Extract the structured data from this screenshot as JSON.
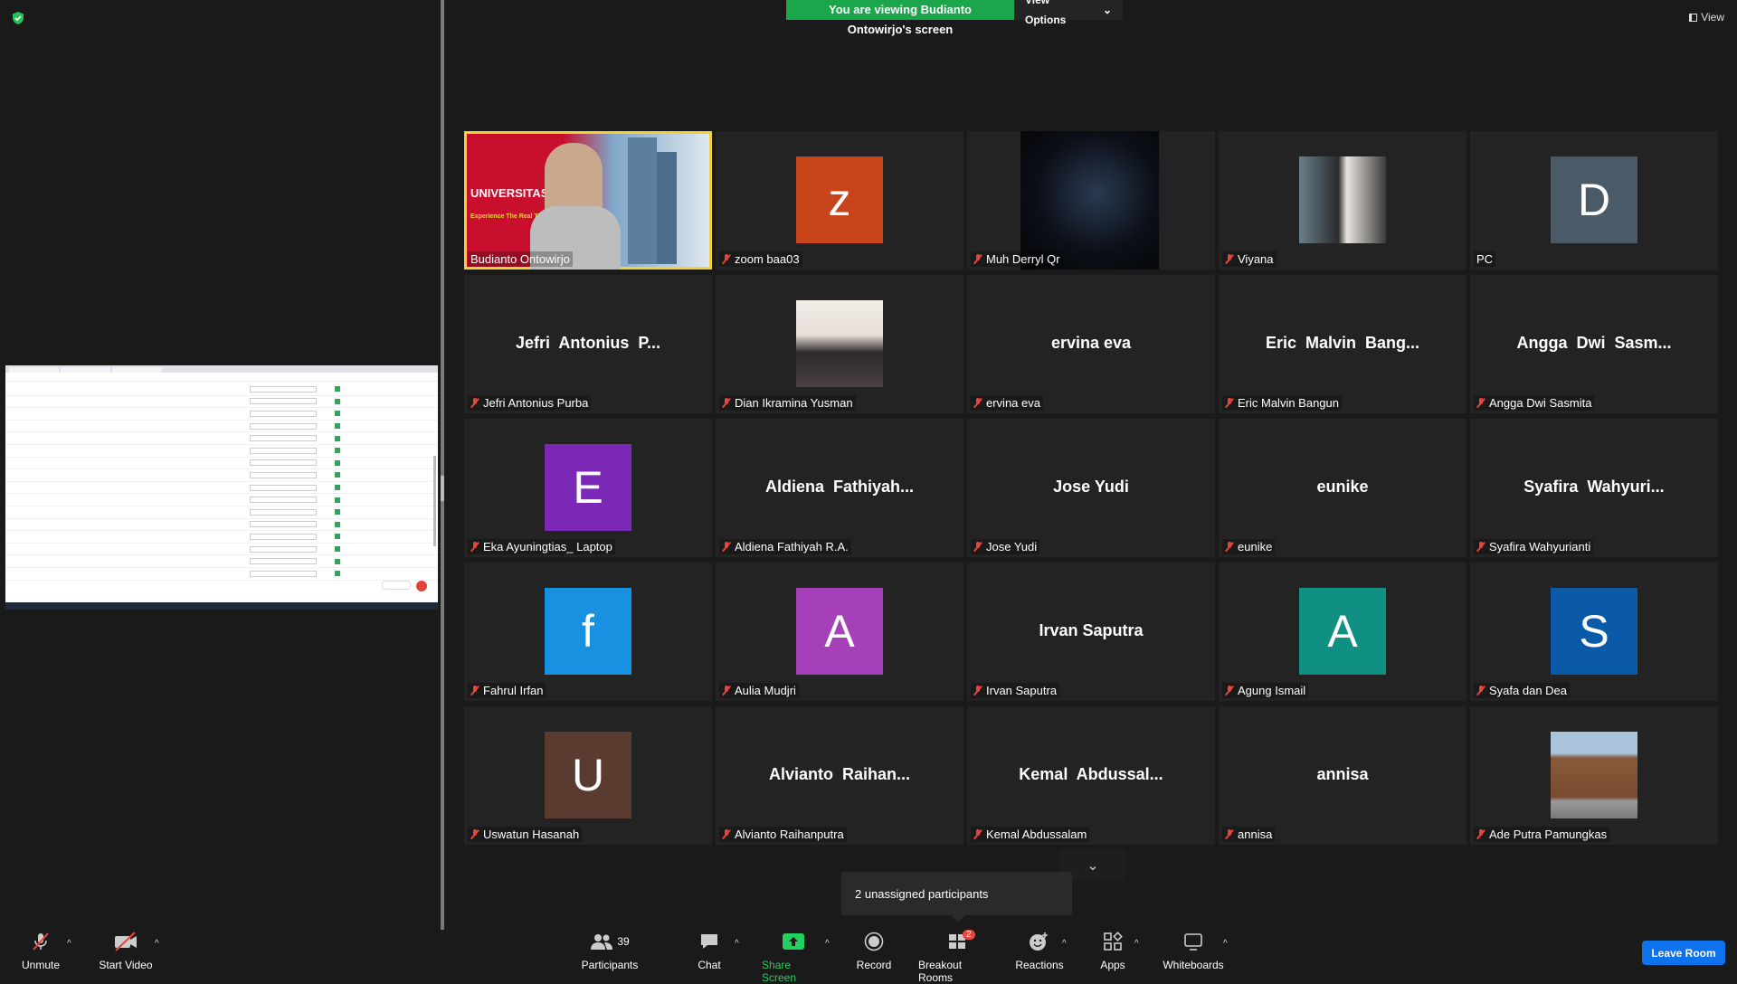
{
  "banner": {
    "viewing_text": "You are viewing Budianto Ontowirjo's screen",
    "view_options": "View Options"
  },
  "view_label": "View",
  "tiles": [
    {
      "display": "video-speaker",
      "name": "Budianto Ontowirjo",
      "muted": false,
      "active": true,
      "overlay": "UNIVERSITAS BAKRIE",
      "overlay2": "Experience The Real T"
    },
    {
      "display": "letter",
      "letter": "z",
      "color": "#c8441a",
      "name": "zoom baa03",
      "muted": true
    },
    {
      "display": "video-dark",
      "name": "Muh Derryl Qr",
      "muted": true
    },
    {
      "display": "photo-pair",
      "name": "Viyana",
      "muted": true
    },
    {
      "display": "letter",
      "letter": "D",
      "color": "#4a5a66",
      "name": "PC",
      "muted": false
    },
    {
      "display": "text",
      "big": "Jefri  Antonius  P...",
      "name": "Jefri Antonius Purba",
      "muted": true
    },
    {
      "display": "photo-woman",
      "name": "Dian Ikramina Yusman",
      "muted": true
    },
    {
      "display": "text",
      "big": "ervina eva",
      "name": "ervina eva",
      "muted": true
    },
    {
      "display": "text",
      "big": "Eric  Malvin  Bang...",
      "name": "Eric Malvin Bangun",
      "muted": true
    },
    {
      "display": "text",
      "big": "Angga  Dwi  Sasm...",
      "name": "Angga Dwi Sasmita",
      "muted": true
    },
    {
      "display": "letter",
      "letter": "E",
      "color": "#7a28b5",
      "name": "Eka Ayuningtias_ Laptop",
      "muted": true
    },
    {
      "display": "text",
      "big": "Aldiena  Fathiyah...",
      "name": "Aldiena Fathiyah R.A.",
      "muted": true
    },
    {
      "display": "text",
      "big": "Jose Yudi",
      "name": "Jose Yudi",
      "muted": true
    },
    {
      "display": "text",
      "big": "eunike",
      "name": "eunike",
      "muted": true
    },
    {
      "display": "text",
      "big": "Syafira  Wahyuri...",
      "name": "Syafira Wahyurianti",
      "muted": true
    },
    {
      "display": "letter",
      "letter": "f",
      "color": "#1791e0",
      "name": "Fahrul Irfan",
      "muted": true
    },
    {
      "display": "letter",
      "letter": "A",
      "color": "#a540b8",
      "name": "Aulia Mudjri",
      "muted": true
    },
    {
      "display": "text",
      "big": "Irvan Saputra",
      "name": "Irvan Saputra",
      "muted": true
    },
    {
      "display": "letter",
      "letter": "A",
      "color": "#0f9082",
      "name": "Agung Ismail",
      "muted": true
    },
    {
      "display": "letter",
      "letter": "S",
      "color": "#0a5aa7",
      "name": "Syafa dan Dea",
      "muted": true
    },
    {
      "display": "letter",
      "letter": "U",
      "color": "#5a3b30",
      "name": "Uswatun Hasanah",
      "muted": true
    },
    {
      "display": "text",
      "big": "Alvianto  Raihan...",
      "name": "Alvianto Raihanputra",
      "muted": true
    },
    {
      "display": "text",
      "big": "Kemal  Abdussal...",
      "name": "Kemal Abdussalam",
      "muted": true
    },
    {
      "display": "text",
      "big": "annisa",
      "name": "annisa",
      "muted": true
    },
    {
      "display": "photo-building",
      "name": "Ade Putra Pamungkas",
      "muted": true
    }
  ],
  "tooltip": "2 unassigned participants",
  "toolbar": {
    "unmute": "Unmute",
    "start_video": "Start Video",
    "participants": "Participants",
    "participants_count": "39",
    "chat": "Chat",
    "share_screen": "Share Screen",
    "record": "Record",
    "breakout_rooms": "Breakout Rooms",
    "breakout_badge": "2",
    "reactions": "Reactions",
    "apps": "Apps",
    "whiteboards": "Whiteboards",
    "leave": "Leave Room"
  },
  "colors": {
    "green_banner": "#1ca64c",
    "leave_blue": "#0e72ed",
    "active_border": "#f2d23c",
    "muted_red": "#e8453c"
  }
}
